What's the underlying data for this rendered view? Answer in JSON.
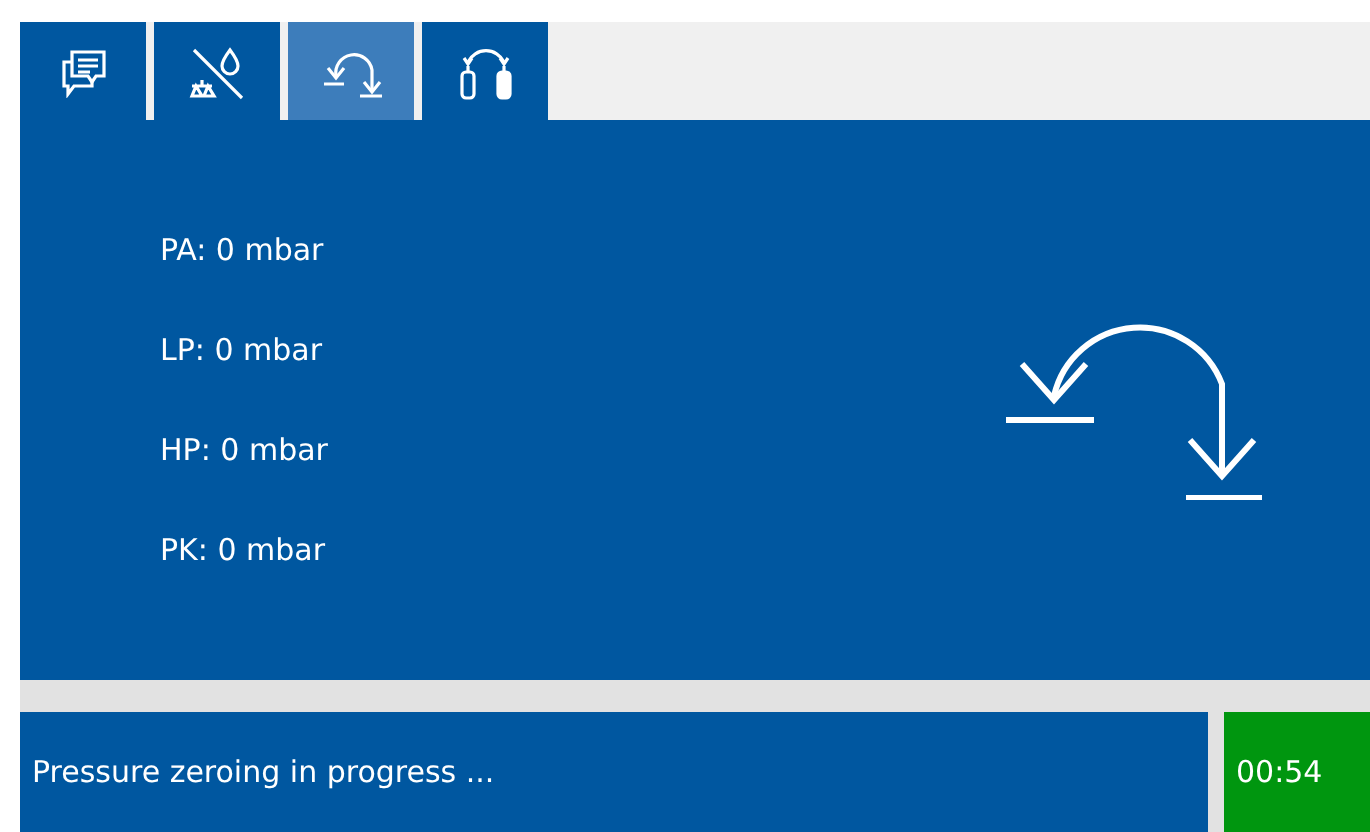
{
  "tabs": [
    {
      "kind": "messages",
      "selected": false
    },
    {
      "kind": "scale",
      "selected": false
    },
    {
      "kind": "zeroing",
      "selected": true
    },
    {
      "kind": "cylinders",
      "selected": false
    }
  ],
  "readings": [
    "PA: 0 mbar",
    "LP: 0 mbar",
    "HP: 0 mbar",
    "PK: 0 mbar"
  ],
  "status": {
    "message": "Pressure zeroing in progress ...",
    "timer": "00:54"
  }
}
